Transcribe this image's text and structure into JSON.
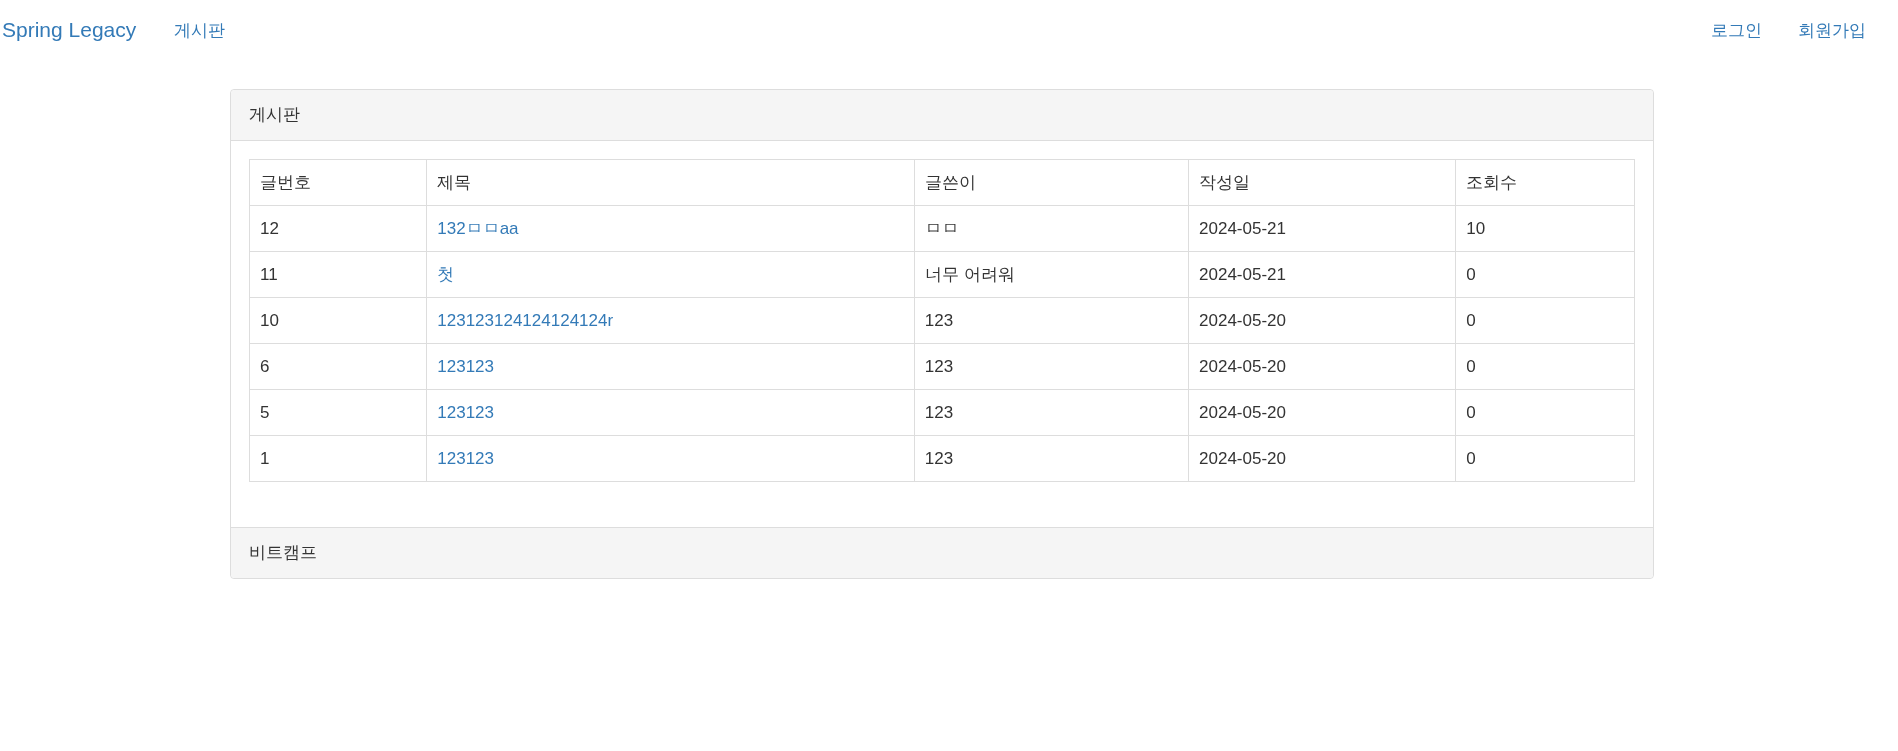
{
  "navbar": {
    "brand": "Spring Legacy",
    "left_links": [
      "게시판"
    ],
    "right_links": [
      "로그인",
      "회원가입"
    ]
  },
  "panel": {
    "heading": "게시판",
    "footer": "비트캠프",
    "table": {
      "columns": [
        "글번호",
        "제목",
        "글쓴이",
        "작성일",
        "조회수"
      ],
      "rows": [
        {
          "number": "12",
          "title": "132ㅁㅁaa",
          "author": "ㅁㅁ",
          "date": "2024-05-21",
          "views": "10"
        },
        {
          "number": "11",
          "title": "첫",
          "author": "너무 어려워",
          "date": "2024-05-21",
          "views": "0"
        },
        {
          "number": "10",
          "title": "123123124124124124r",
          "author": "123",
          "date": "2024-05-20",
          "views": "0"
        },
        {
          "number": "6",
          "title": "123123",
          "author": "123",
          "date": "2024-05-20",
          "views": "0"
        },
        {
          "number": "5",
          "title": "123123",
          "author": "123",
          "date": "2024-05-20",
          "views": "0"
        },
        {
          "number": "1",
          "title": "123123",
          "author": "123",
          "date": "2024-05-20",
          "views": "0"
        }
      ]
    }
  }
}
